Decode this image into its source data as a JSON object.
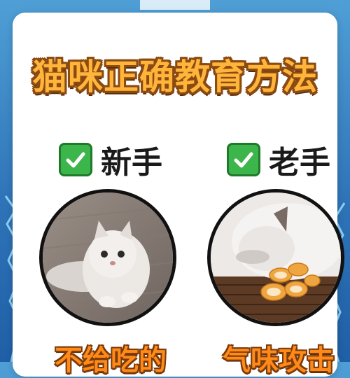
{
  "page": {
    "title": "猫咪正确教育方法"
  },
  "columns": [
    {
      "label": "新手",
      "caption": "不给吃的",
      "check_icon": "check-mark-icon",
      "photo": "cat-crouching-on-wooden-floor"
    },
    {
      "label": "老手",
      "caption": "气味攻击",
      "check_icon": "check-mark-icon",
      "photo": "cat-sniffing-orange-peels"
    }
  ],
  "colors": {
    "background": "#2f74b8",
    "card": "#ffffff",
    "title": "#ffb43a",
    "caption": "#ff8a18",
    "check": "#3cb54a"
  }
}
